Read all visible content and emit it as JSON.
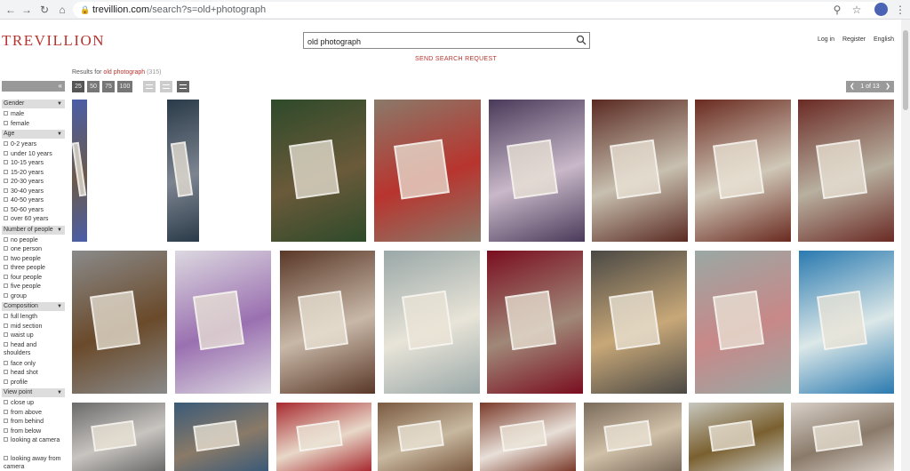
{
  "browser": {
    "url_domain": "trevillion.com",
    "url_path": "/search?s=old+photograph",
    "back_icon": "arrow-left-icon",
    "forward_icon": "arrow-right-icon",
    "reload_icon": "reload-icon",
    "home_icon": "home-icon"
  },
  "site": {
    "logo": "TREVILLION",
    "search_value": "old photograph",
    "send_request": "SEND SEARCH REQUEST",
    "links": [
      "Log in",
      "Register",
      "English"
    ]
  },
  "results": {
    "prefix": "Results for",
    "query": "old photograph",
    "count": "(315)"
  },
  "per_page": [
    "25",
    "50",
    "75",
    "100"
  ],
  "pager": {
    "label": "1 of 13"
  },
  "sidebar": {
    "collapse_icon": "double-chevron-left-icon",
    "sections": [
      {
        "title": "Gender",
        "options": [
          "male",
          "female"
        ]
      },
      {
        "title": "Age",
        "options": [
          "0-2 years",
          "under 10 years",
          "10-15 years",
          "15-20 years",
          "20-30 years",
          "30-40 years",
          "40-50 years",
          "50-60 years",
          "over 60 years"
        ]
      },
      {
        "title": "Number of people",
        "options": [
          "no people",
          "one person",
          "two people",
          "three people",
          "four people",
          "five people",
          "group"
        ]
      },
      {
        "title": "Composition",
        "options": [
          "full length",
          "mid section",
          "waist up",
          "head and shoulders",
          "face only",
          "head shot",
          "profile"
        ]
      },
      {
        "title": "View point",
        "options": [
          "close up",
          "from above",
          "from behind",
          "from below",
          "looking at camera",
          "looking away from camera"
        ]
      }
    ]
  },
  "colors": {
    "brand": "#b5342e"
  }
}
